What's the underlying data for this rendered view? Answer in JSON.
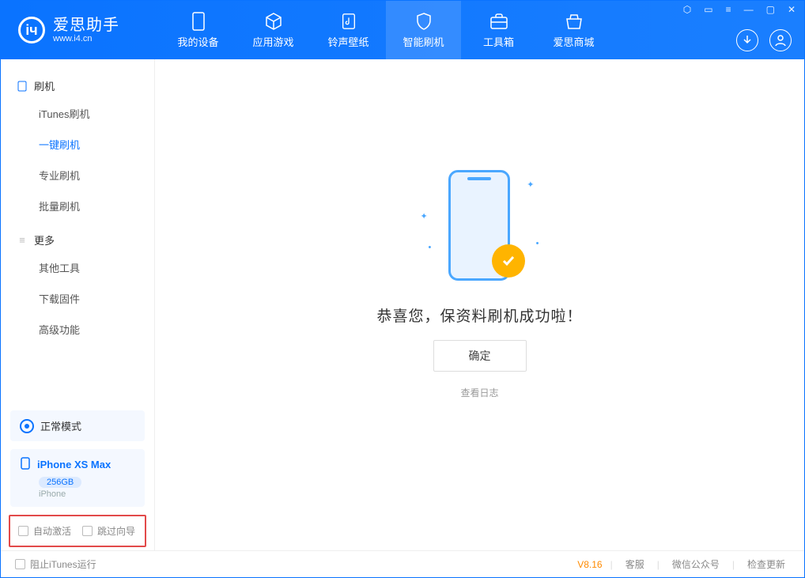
{
  "app": {
    "name_cn": "爱思助手",
    "name_en": "www.i4.cn"
  },
  "nav": [
    {
      "label": "我的设备",
      "icon": "device"
    },
    {
      "label": "应用游戏",
      "icon": "cube"
    },
    {
      "label": "铃声壁纸",
      "icon": "music"
    },
    {
      "label": "智能刷机",
      "icon": "shield",
      "active": true
    },
    {
      "label": "工具箱",
      "icon": "toolbox"
    },
    {
      "label": "爱思商城",
      "icon": "store"
    }
  ],
  "sidebar": {
    "sect_flash": "刷机",
    "flash_items": [
      {
        "label": "iTunes刷机"
      },
      {
        "label": "一键刷机",
        "active": true
      },
      {
        "label": "专业刷机"
      },
      {
        "label": "批量刷机"
      }
    ],
    "sect_more": "更多",
    "more_items": [
      {
        "label": "其他工具"
      },
      {
        "label": "下载固件"
      },
      {
        "label": "高级功能"
      }
    ],
    "mode": "正常模式",
    "device": {
      "name": "iPhone XS Max",
      "storage": "256GB",
      "type": "iPhone"
    },
    "chk_auto": "自动激活",
    "chk_skip": "跳过向导"
  },
  "main": {
    "message": "恭喜您，保资料刷机成功啦！",
    "ok": "确定",
    "view_log": "查看日志"
  },
  "footer": {
    "block_itunes": "阻止iTunes运行",
    "version": "V8.16",
    "link_cs": "客服",
    "link_wx": "微信公众号",
    "link_upd": "检查更新"
  }
}
